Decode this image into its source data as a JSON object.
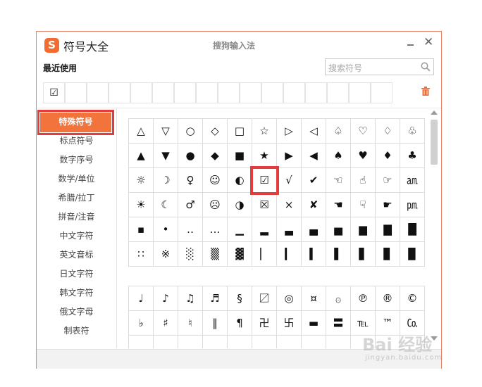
{
  "window": {
    "logo": "S",
    "title": "符号大全",
    "app_name": "搜狗输入法",
    "minimize": "–",
    "close": "✕"
  },
  "recent": {
    "label": "最近使用",
    "symbols": [
      "☑",
      "",
      "",
      "",
      "",
      "",
      "",
      "",
      "",
      "",
      "",
      "",
      "",
      "",
      "",
      ""
    ]
  },
  "search": {
    "placeholder": "搜索符号"
  },
  "sidebar": {
    "items": [
      {
        "label": "特殊符号",
        "active": true
      },
      {
        "label": "标点符号"
      },
      {
        "label": "数字序号"
      },
      {
        "label": "数学/单位"
      },
      {
        "label": "希腊/拉丁"
      },
      {
        "label": "拼音/注音"
      },
      {
        "label": "中文字符"
      },
      {
        "label": "英文音标"
      },
      {
        "label": "日文字符"
      },
      {
        "label": "韩文字符"
      },
      {
        "label": "俄文字母"
      },
      {
        "label": "制表符"
      }
    ]
  },
  "grid1": [
    [
      "△",
      "▽",
      "○",
      "◇",
      "□",
      "☆",
      "▷",
      "◁",
      "♤",
      "♡",
      "♢",
      "♧"
    ],
    [
      "▲",
      "▼",
      "●",
      "◆",
      "■",
      "★",
      "▶",
      "◀",
      "♠",
      "♥",
      "♦",
      "♣"
    ],
    [
      "☼",
      "☽",
      "♀",
      "☺",
      "◐",
      "☑",
      "√",
      "✔",
      "☜",
      "☝",
      "☞",
      "㏂"
    ],
    [
      "☀",
      "☾",
      "♂",
      "☹",
      "◑",
      "☒",
      "×",
      "✘",
      "☚",
      "☟",
      "☛",
      "㏘"
    ],
    [
      "▪",
      "•",
      "‥",
      "…",
      "▁",
      "▂",
      "▃",
      "▄",
      "▅",
      "▆",
      "▇",
      "█"
    ],
    [
      "∷",
      "※",
      "░",
      "▒",
      "▓",
      "▏",
      "▎",
      "▍",
      "▌",
      "▋",
      "▊",
      "▉"
    ]
  ],
  "grid2": [
    [
      "♩",
      "♪",
      "♫",
      "♬",
      "§",
      "〼",
      "◎",
      "¤",
      "۞",
      "℗",
      "®",
      "©"
    ],
    [
      "♭",
      "♯",
      "♮",
      "‖",
      "¶",
      "卍",
      "卐",
      "▬",
      "〓",
      "℡",
      "™",
      "㏇"
    ],
    [
      "",
      "",
      "",
      "",
      "",
      "",
      "",
      "",
      "",
      "",
      "",
      ""
    ]
  ],
  "highlighted_symbol": "☑",
  "watermark": {
    "main": "Bai 经验",
    "sub": "jingyan.baidu.com"
  },
  "colors": {
    "accent": "#f2733c",
    "highlight": "#e23c3c",
    "border": "#e8826a"
  }
}
